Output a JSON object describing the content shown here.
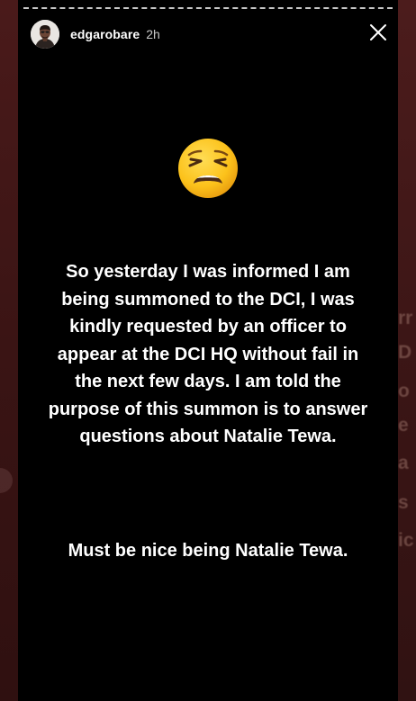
{
  "story": {
    "username": "edgarobare",
    "timestamp": "2h",
    "emoji": "weary-face",
    "message_lines": [
      "So yesterday I was informed I am",
      "being summoned to the DCI, I was",
      "kindly requested by an officer to",
      "appear at the DCI HQ without fail in",
      "the next few days. I am told the",
      "purpose of this summon is to answer",
      "questions about Natalie Tewa."
    ],
    "closing_line": "Must be nice being Natalie Tewa."
  },
  "icons": {
    "close": "close-icon",
    "avatar": "avatar"
  },
  "colors": {
    "story_background": "#000000",
    "side_background": "#3b1515",
    "text": "#ffffff",
    "emoji_face": "#fcc21b"
  }
}
